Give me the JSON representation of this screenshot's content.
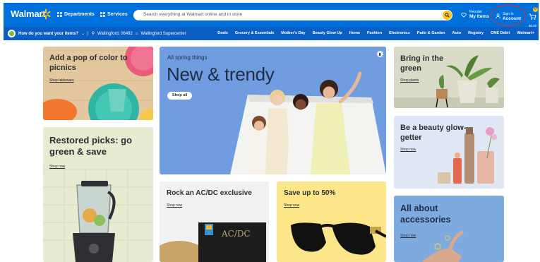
{
  "header": {
    "logo": "Walmart",
    "departments": "Departments",
    "services": "Services",
    "search_placeholder": "Search everything at Walmart online and in store",
    "reorder_small": "Reorder",
    "reorder_big": "My Items",
    "signin_small": "Sign In",
    "signin_big": "Account",
    "cart_count": "0",
    "cart_total": "$0.00"
  },
  "subbar": {
    "question": "How do you want your items?",
    "zip": "Wallingford, 06492",
    "store": "Wallingford Supercenter",
    "departments": [
      "Deals",
      "Grocery & Essentials",
      "Mother's Day",
      "Beauty Glow Up",
      "Home",
      "Fashion",
      "Electronics",
      "Patio & Garden",
      "Auto",
      "Registry",
      "ONE Debit",
      "Walmart+"
    ]
  },
  "cards": {
    "picnic": {
      "title": "Add a pop of color to picnics",
      "link": "Shop tableware"
    },
    "restored": {
      "title": "Restored picks: go green & save",
      "link": "Shop now"
    },
    "spring": {
      "eyebrow": "All spring things",
      "headline": "New & trendy",
      "button": "Shop all"
    },
    "acdc": {
      "title": "Rock an AC/DC exclusive",
      "link": "Shop now",
      "album": "AC/DC"
    },
    "save": {
      "title": "Save up to 50%",
      "link": "Shop now"
    },
    "garden": {
      "title": "Bring in the green",
      "link": "Shop plants"
    },
    "beauty": {
      "title": "Be a beauty glow-getter",
      "link": "Shop now"
    },
    "acc": {
      "title": "All about accessories",
      "link": "Shop now"
    }
  },
  "colors": {
    "brand_blue": "#0071dc",
    "spark_yellow": "#ffc220",
    "annotation_red": "#d0312d"
  }
}
